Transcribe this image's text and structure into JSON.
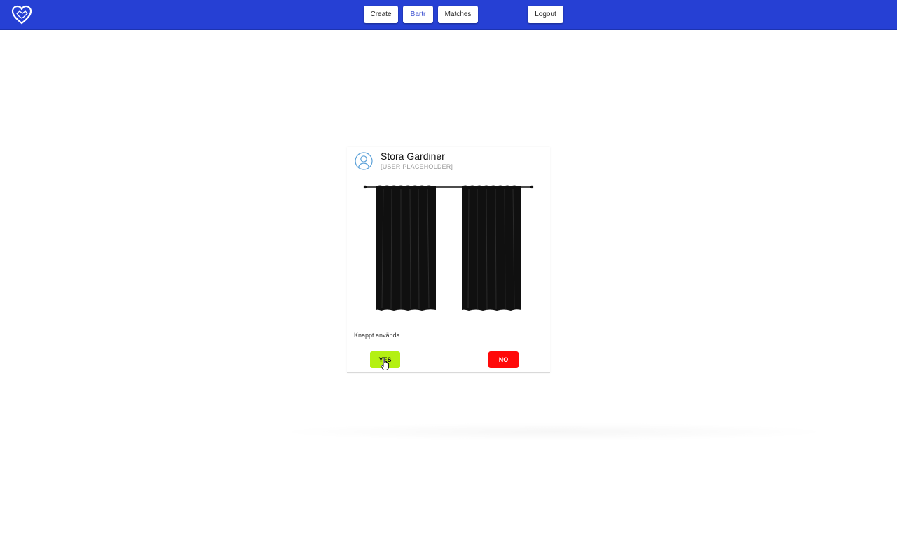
{
  "nav": {
    "create_label": "Create",
    "bartr_label": "Bartr",
    "matches_label": "Matches",
    "logout_label": "Logout",
    "logo_icon": "heart-handshake-logo-icon"
  },
  "card": {
    "title": "Stora Gardiner",
    "subtitle": "[USER PLACEHOLDER]",
    "avatar_icon": "user-circle-icon",
    "image": "black-curtains-on-rod",
    "description": "Knappt använda",
    "yes_label": "YES",
    "no_label": "NO"
  },
  "colors": {
    "topbar": "#2640d4",
    "yes": "#b4f012",
    "no": "#ff0a0a",
    "active_nav_text": "#3a4fd0"
  }
}
